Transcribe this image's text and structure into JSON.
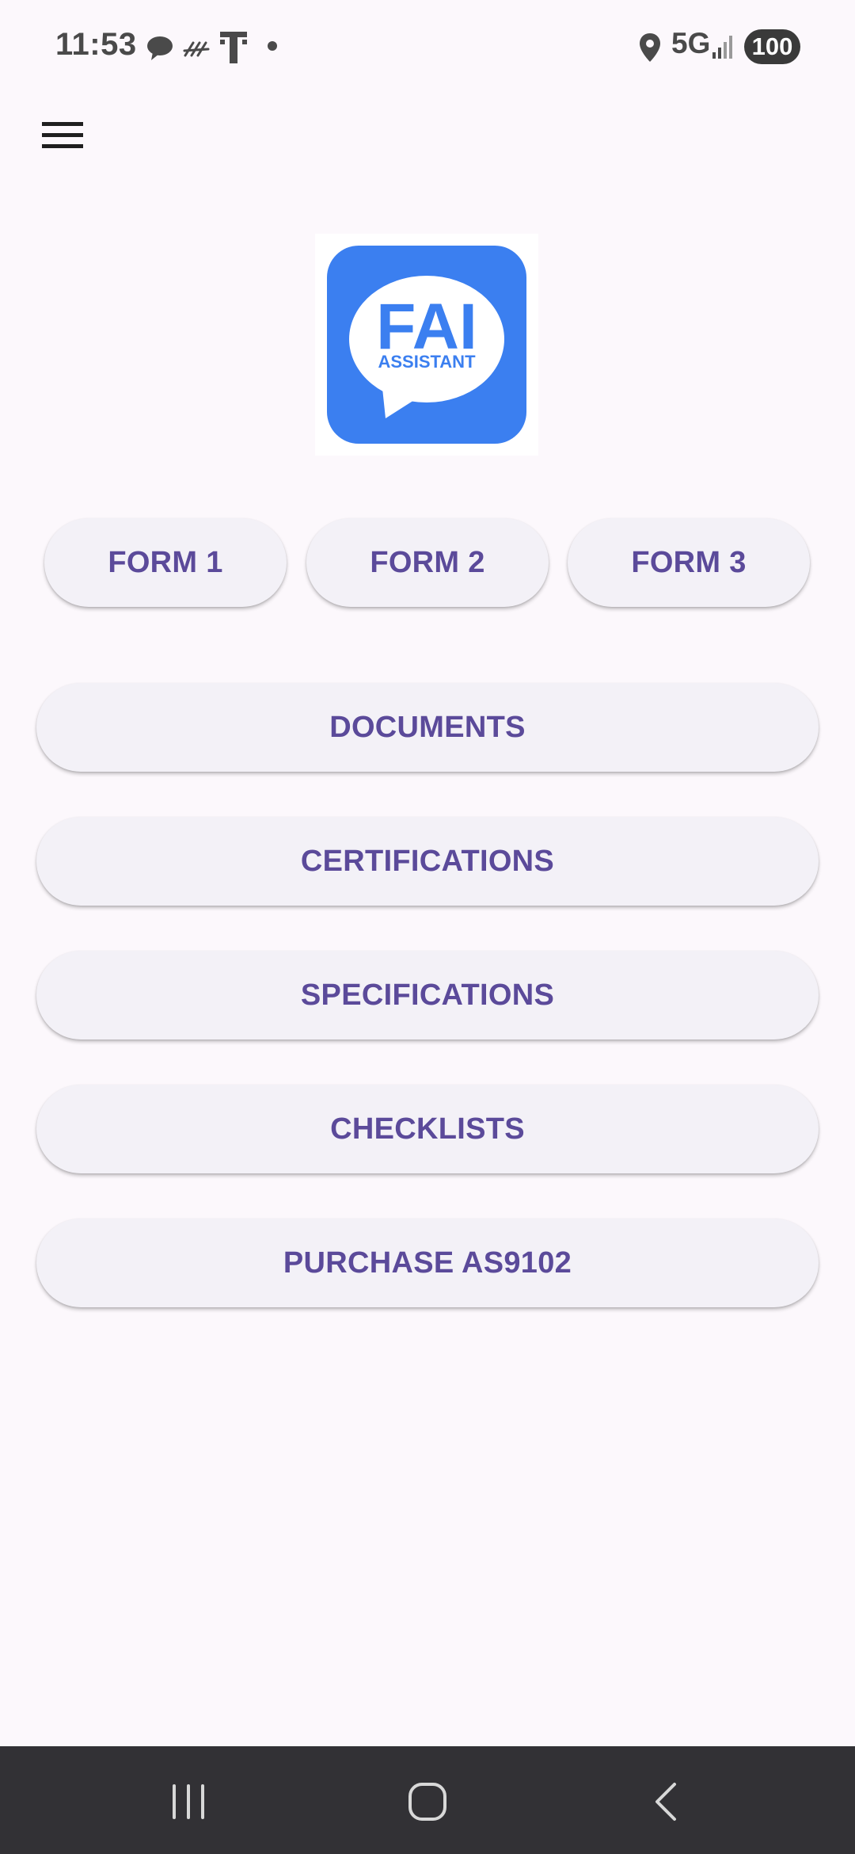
{
  "status_bar": {
    "time": "11:53",
    "network": "5G",
    "battery": "100",
    "icons": [
      "chat-bubble-icon",
      "no-data-icon",
      "t-mobile-icon",
      "dot-icon",
      "location-icon",
      "signal-icon"
    ]
  },
  "app_bar": {
    "menu_icon": "hamburger-menu-icon"
  },
  "logo": {
    "main_text": "FAI",
    "sub_text": "ASSISTANT",
    "color": "#3b7ff0"
  },
  "form_buttons": [
    {
      "label": "FORM 1"
    },
    {
      "label": "FORM 2"
    },
    {
      "label": "FORM 3"
    }
  ],
  "menu_buttons": [
    {
      "label": "DOCUMENTS"
    },
    {
      "label": "CERTIFICATIONS"
    },
    {
      "label": "SPECIFICATIONS"
    },
    {
      "label": "CHECKLISTS"
    },
    {
      "label": "PURCHASE AS9102"
    }
  ],
  "nav_bar": {
    "items": [
      "recent-apps-icon",
      "home-icon",
      "back-icon"
    ]
  },
  "colors": {
    "background": "#fcf8fc",
    "button_background": "#f3f1f7",
    "button_text": "#5b4a9a",
    "nav_bar": "#323135"
  }
}
